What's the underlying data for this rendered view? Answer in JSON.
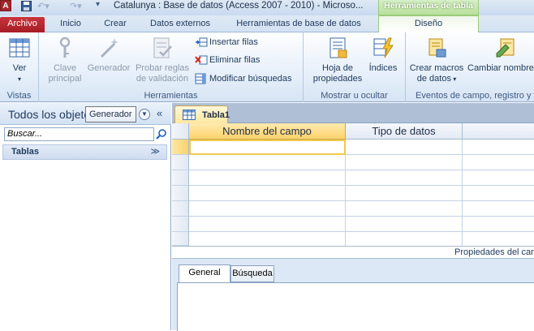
{
  "titlebar": {
    "title": "Catalunya : Base de datos (Access 2007 - 2010)  -  Microso...",
    "context_group": "Herramientas de tabla",
    "app_icon": "A"
  },
  "tabs": {
    "archivo": "Archivo",
    "inicio": "Inicio",
    "crear": "Crear",
    "datos_externos": "Datos externos",
    "herramientas_bd": "Herramientas de base de datos",
    "diseno": "Diseño"
  },
  "ribbon": {
    "vistas": {
      "ver": "Ver",
      "label": "Vistas"
    },
    "herramientas": {
      "clave": "Clave principal",
      "generador": "Generador",
      "probar": "Probar reglas de validación",
      "insertar": "Insertar filas",
      "eliminar": "Eliminar filas",
      "modificar": "Modificar búsquedas",
      "label": "Herramientas"
    },
    "mostrar": {
      "hoja": "Hoja de propiedades",
      "indices": "Índices",
      "label": "Mostrar u ocultar"
    },
    "eventos": {
      "crear_macros": "Crear macros de datos",
      "cambiar": "Cambiar nombre/Eliminar",
      "label": "Eventos de campo, registro y tabla"
    }
  },
  "navpane": {
    "title": "Todos los objetos de Access",
    "tooltip": "Generador",
    "search_placeholder": "Buscar...",
    "group": "Tablas"
  },
  "document": {
    "tab": "Tabla1",
    "col_name": "Nombre del campo",
    "col_type": "Tipo de datos",
    "properties_label": "Propiedades del campo",
    "tab_general": "General",
    "tab_busqueda": "Búsqueda"
  },
  "colors": {
    "context_green": "#b9e09c",
    "archivo_red": "#b7252c",
    "ribbon_blue": "#d7e4f4"
  }
}
